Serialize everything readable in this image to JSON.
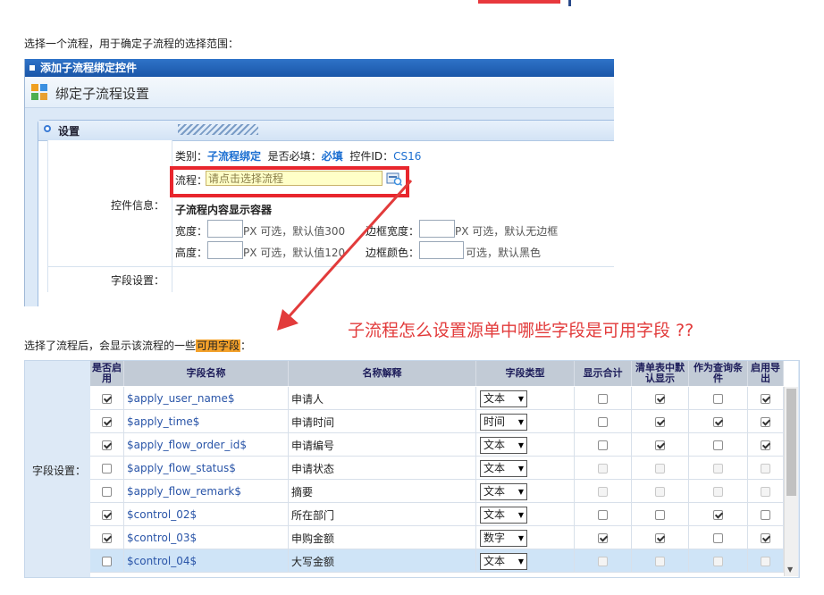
{
  "intro_text": "选择一个流程，用于确定子流程的选择范围：",
  "panel": {
    "title": "添加子流程绑定控件",
    "header_title": "绑定子流程设置",
    "settings_label": "设置",
    "control_info_label": "控件信息：",
    "meta": {
      "category_label": "类别：",
      "category_value": "子流程绑定",
      "required_label": "是否必填：",
      "required_value": "必填",
      "control_id_label": "控件ID：",
      "control_id_value": "CS16"
    },
    "flow_label": "流程：",
    "flow_placeholder": "请点击选择流程",
    "container_heading": "子流程内容显示容器",
    "width_label": "宽度：",
    "width_hint": "PX 可选，默认值300",
    "height_label": "高度：",
    "height_hint": "PX 可选，默认值120",
    "border_width_label": "边框宽度：",
    "border_width_hint": "PX 可选，默认无边框",
    "border_color_label": "边框颜色：",
    "border_color_hint": "可选，默认黑色",
    "field_settings_label": "字段设置："
  },
  "annotation": "子流程怎么设置源单中哪些字段是可用字段 ??",
  "after_text_prefix": "选择了流程后，会显示该流程的一些",
  "after_text_highlight": "可用字段",
  "after_text_suffix": "：",
  "field_table": {
    "side_label": "字段设置：",
    "headers": {
      "enable": "是否启用",
      "field_name": "字段名称",
      "description": "名称解释",
      "field_type": "字段类型",
      "show_total": "显示合计",
      "default_show": "清单表中默认显示",
      "query_cond": "作为查询条件",
      "export": "启用导出"
    },
    "rows": [
      {
        "enable": true,
        "name": "$apply_user_name$",
        "desc": "申请人",
        "type": "文本",
        "total": false,
        "total_dis": false,
        "show": true,
        "query": false,
        "export": true,
        "row_dis": false
      },
      {
        "enable": true,
        "name": "$apply_time$",
        "desc": "申请时间",
        "type": "时间",
        "total": false,
        "total_dis": false,
        "show": true,
        "query": true,
        "export": true,
        "row_dis": false
      },
      {
        "enable": true,
        "name": "$apply_flow_order_id$",
        "desc": "申请编号",
        "type": "文本",
        "total": false,
        "total_dis": false,
        "show": true,
        "query": false,
        "export": true,
        "row_dis": false
      },
      {
        "enable": false,
        "name": "$apply_flow_status$",
        "desc": "申请状态",
        "type": "文本",
        "total": false,
        "total_dis": true,
        "show": false,
        "query": false,
        "export": false,
        "row_dis": true
      },
      {
        "enable": false,
        "name": "$apply_flow_remark$",
        "desc": "摘要",
        "type": "文本",
        "total": false,
        "total_dis": true,
        "show": false,
        "query": false,
        "export": false,
        "row_dis": true
      },
      {
        "enable": true,
        "name": "$control_02$",
        "desc": "所在部门",
        "type": "文本",
        "total": false,
        "total_dis": false,
        "show": false,
        "query": true,
        "export": false,
        "row_dis": false
      },
      {
        "enable": true,
        "name": "$control_03$",
        "desc": "申购金额",
        "type": "数字",
        "total": true,
        "total_dis": false,
        "show": true,
        "query": false,
        "export": true,
        "row_dis": false
      },
      {
        "enable": false,
        "name": "$control_04$",
        "desc": "大写金额",
        "type": "文本",
        "total": false,
        "total_dis": true,
        "show": false,
        "query": false,
        "export": false,
        "row_dis": true
      }
    ]
  },
  "colors": {
    "annotation": "#e23b3b",
    "highlight": "#f3a12a",
    "red_box": "#e8262d",
    "link_blue": "#1c6fd1",
    "flow_input_bg": "#ffffc8"
  }
}
